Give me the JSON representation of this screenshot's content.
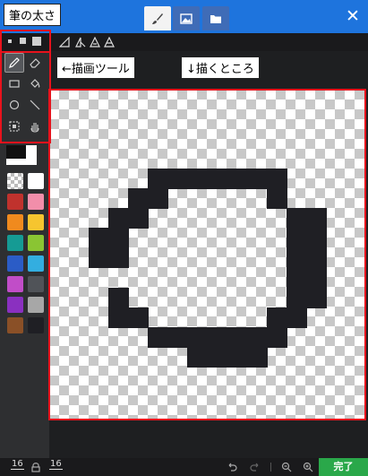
{
  "annotations": {
    "brush_size": "筆の太さ",
    "draw_tools": "←描画ツール",
    "draw_area": "↓描くところ"
  },
  "colors": {
    "topbar": "#1e74dd",
    "pixel": "#1f1f24",
    "annotation_border": "#e8121c",
    "done_button": "#2aa84a"
  },
  "header": {
    "close_symbol": "✕",
    "tabs": [
      {
        "name": "brush-tab",
        "icon": "brush-icon",
        "active": true
      },
      {
        "name": "image-tab",
        "icon": "image-icon",
        "active": false
      },
      {
        "name": "folder-tab",
        "icon": "folder-icon",
        "active": false
      }
    ]
  },
  "tools": [
    {
      "name": "pencil-tool",
      "icon": "pencil-icon",
      "selected": true
    },
    {
      "name": "eraser-tool",
      "icon": "eraser-icon",
      "selected": false
    },
    {
      "name": "rectangle-tool",
      "icon": "rectangle-icon",
      "selected": false
    },
    {
      "name": "fill-tool",
      "icon": "paint-bucket-icon",
      "selected": false
    },
    {
      "name": "ellipse-tool",
      "icon": "circle-icon",
      "selected": false
    },
    {
      "name": "line-tool",
      "icon": "line-icon",
      "selected": false
    },
    {
      "name": "select-tool",
      "icon": "select-icon",
      "selected": false
    },
    {
      "name": "hand-tool",
      "icon": "hand-icon",
      "selected": false
    }
  ],
  "palette": [
    "transparent",
    "#ffffff",
    "#c0322d",
    "#f28eaa",
    "#f08a1e",
    "#f6c52f",
    "#159b94",
    "#8ac533",
    "#2b5cc6",
    "#33aee0",
    "#c14dc8",
    "#505358",
    "#8a30c0",
    "#a7a7a7",
    "#8a5027",
    "#1f1f24"
  ],
  "bottom": {
    "width_value": "16",
    "height_value": "16",
    "done_label": "完了"
  }
}
